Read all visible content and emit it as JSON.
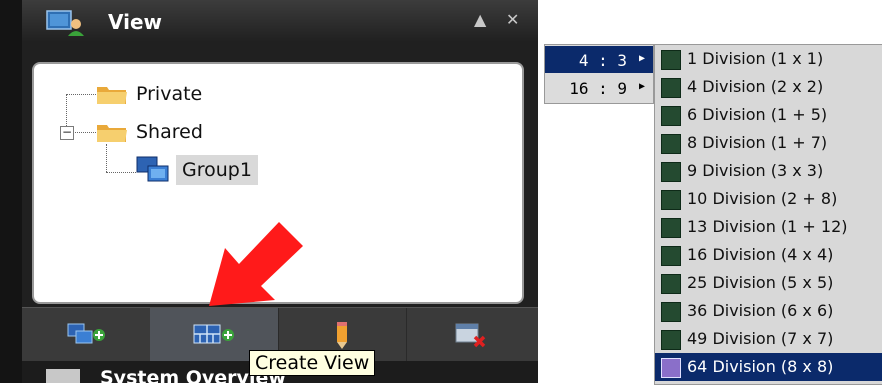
{
  "left_panel": {
    "title": "View",
    "window_buttons": {
      "collapse": "▲",
      "close": "✕"
    },
    "tree": {
      "items": [
        {
          "label": "Private",
          "icon": "folder-icon"
        },
        {
          "label": "Shared",
          "icon": "folder-icon",
          "expander": "−"
        },
        {
          "label": "Group1",
          "icon": "monitors-icon",
          "selected": true
        }
      ]
    },
    "toolbar": {
      "buttons": [
        {
          "name": "add-group-button",
          "icon": "add-group-icon"
        },
        {
          "name": "create-view-button",
          "icon": "create-view-icon"
        },
        {
          "name": "edit-button",
          "icon": "pencil-icon"
        },
        {
          "name": "delete-button",
          "icon": "delete-icon"
        }
      ]
    },
    "tooltip": "Create View",
    "bottom_title": "System Overview"
  },
  "aspect_menu": {
    "items": [
      {
        "label": "4 : 3",
        "active": true
      },
      {
        "label": "16 : 9",
        "active": false
      }
    ]
  },
  "division_menu": {
    "items": [
      {
        "label": "1 Division (1 x 1)"
      },
      {
        "label": "4 Division (2 x 2)"
      },
      {
        "label": "6 Division (1 + 5)"
      },
      {
        "label": "8 Division (1 + 7)"
      },
      {
        "label": "9 Division (3 x 3)"
      },
      {
        "label": "10 Division (2 + 8)"
      },
      {
        "label": "13 Division (1 + 12)"
      },
      {
        "label": "16 Division (4 x 4)"
      },
      {
        "label": "25 Division (5 x 5)"
      },
      {
        "label": "36 Division (6 x 6)"
      },
      {
        "label": "49 Division (7 x 7)"
      },
      {
        "label": "64 Division (8 x 8)",
        "active": true
      }
    ]
  },
  "colors": {
    "menu_highlight": "#0b2a6b",
    "arrow": "#ff1a1a",
    "tooltip_bg": "#ffffe1"
  }
}
